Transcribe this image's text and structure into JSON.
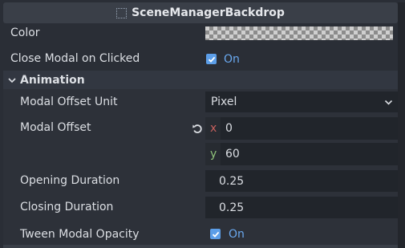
{
  "header": {
    "title": "SceneManagerBackdrop",
    "icon": "node-icon"
  },
  "properties": {
    "color": {
      "label": "Color"
    },
    "close_modal": {
      "label": "Close Modal on Clicked",
      "value": "On",
      "checked": true
    }
  },
  "animation": {
    "title": "Animation",
    "modal_offset_unit": {
      "label": "Modal Offset Unit",
      "value": "Pixel"
    },
    "modal_offset": {
      "label": "Modal Offset",
      "x_axis": "x",
      "x_value": "0",
      "y_axis": "y",
      "y_value": "60"
    },
    "opening_duration": {
      "label": "Opening Duration",
      "value": "0.25"
    },
    "closing_duration": {
      "label": "Closing Duration",
      "value": "0.25"
    },
    "tween_modal_opacity": {
      "label": "Tween Modal Opacity",
      "value": "On",
      "checked": true
    }
  },
  "colors": {
    "accent": "#5c9ee8",
    "on_text": "#6aa9f0",
    "x_axis": "#c7605d",
    "y_axis": "#8fc27a"
  }
}
